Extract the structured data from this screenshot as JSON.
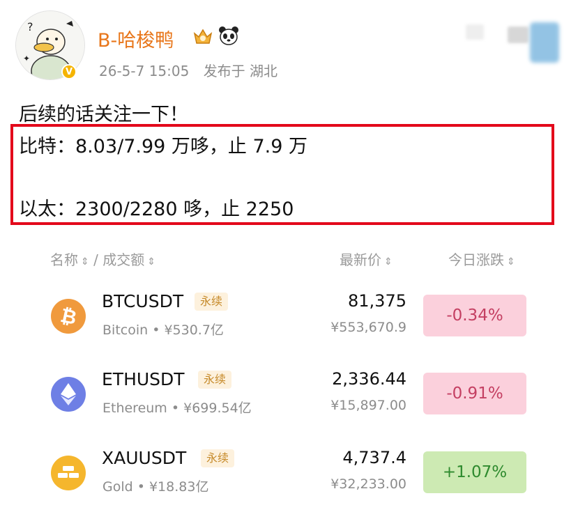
{
  "post": {
    "author": "B-哈梭鸭",
    "timestamp": "26-5-7 15:05",
    "location_label": "发布于 湖北",
    "text_line1": "后续的话关注一下！",
    "text_line2": "比特：8.03/7.99 万哆，止 7.9 万",
    "text_line3": "以太：2300/2280 哆，止 2250",
    "highlight_color": "#e3081b"
  },
  "market": {
    "header": {
      "name": "名称",
      "separator": "/",
      "volume": "成交额",
      "latest_price": "最新价",
      "daily_change": "今日涨跌"
    },
    "rows": [
      {
        "symbol": "BTCUSDT",
        "tag": "永续",
        "subtitle": "Bitcoin • ¥530.7亿",
        "price": "81,375",
        "price_cny": "¥553,670.9",
        "change": "-0.34%",
        "direction": "down",
        "icon": "bitcoin-icon"
      },
      {
        "symbol": "ETHUSDT",
        "tag": "永续",
        "subtitle": "Ethereum • ¥699.54亿",
        "price": "2,336.44",
        "price_cny": "¥15,897.00",
        "change": "-0.91%",
        "direction": "down",
        "icon": "ethereum-icon"
      },
      {
        "symbol": "XAUUSDT",
        "tag": "永续",
        "subtitle": "Gold • ¥18.83亿",
        "price": "4,737.4",
        "price_cny": "¥32,233.00",
        "change": "+1.07%",
        "direction": "up",
        "icon": "gold-bars-icon"
      }
    ]
  },
  "colors": {
    "author": "#e8761a",
    "down_bg": "#fbd0dc",
    "down_text": "#c43f62",
    "up_bg": "#cdeab3",
    "up_text": "#2e8a2e",
    "tag_bg": "#fdf1dd",
    "tag_text": "#c68a2a"
  }
}
